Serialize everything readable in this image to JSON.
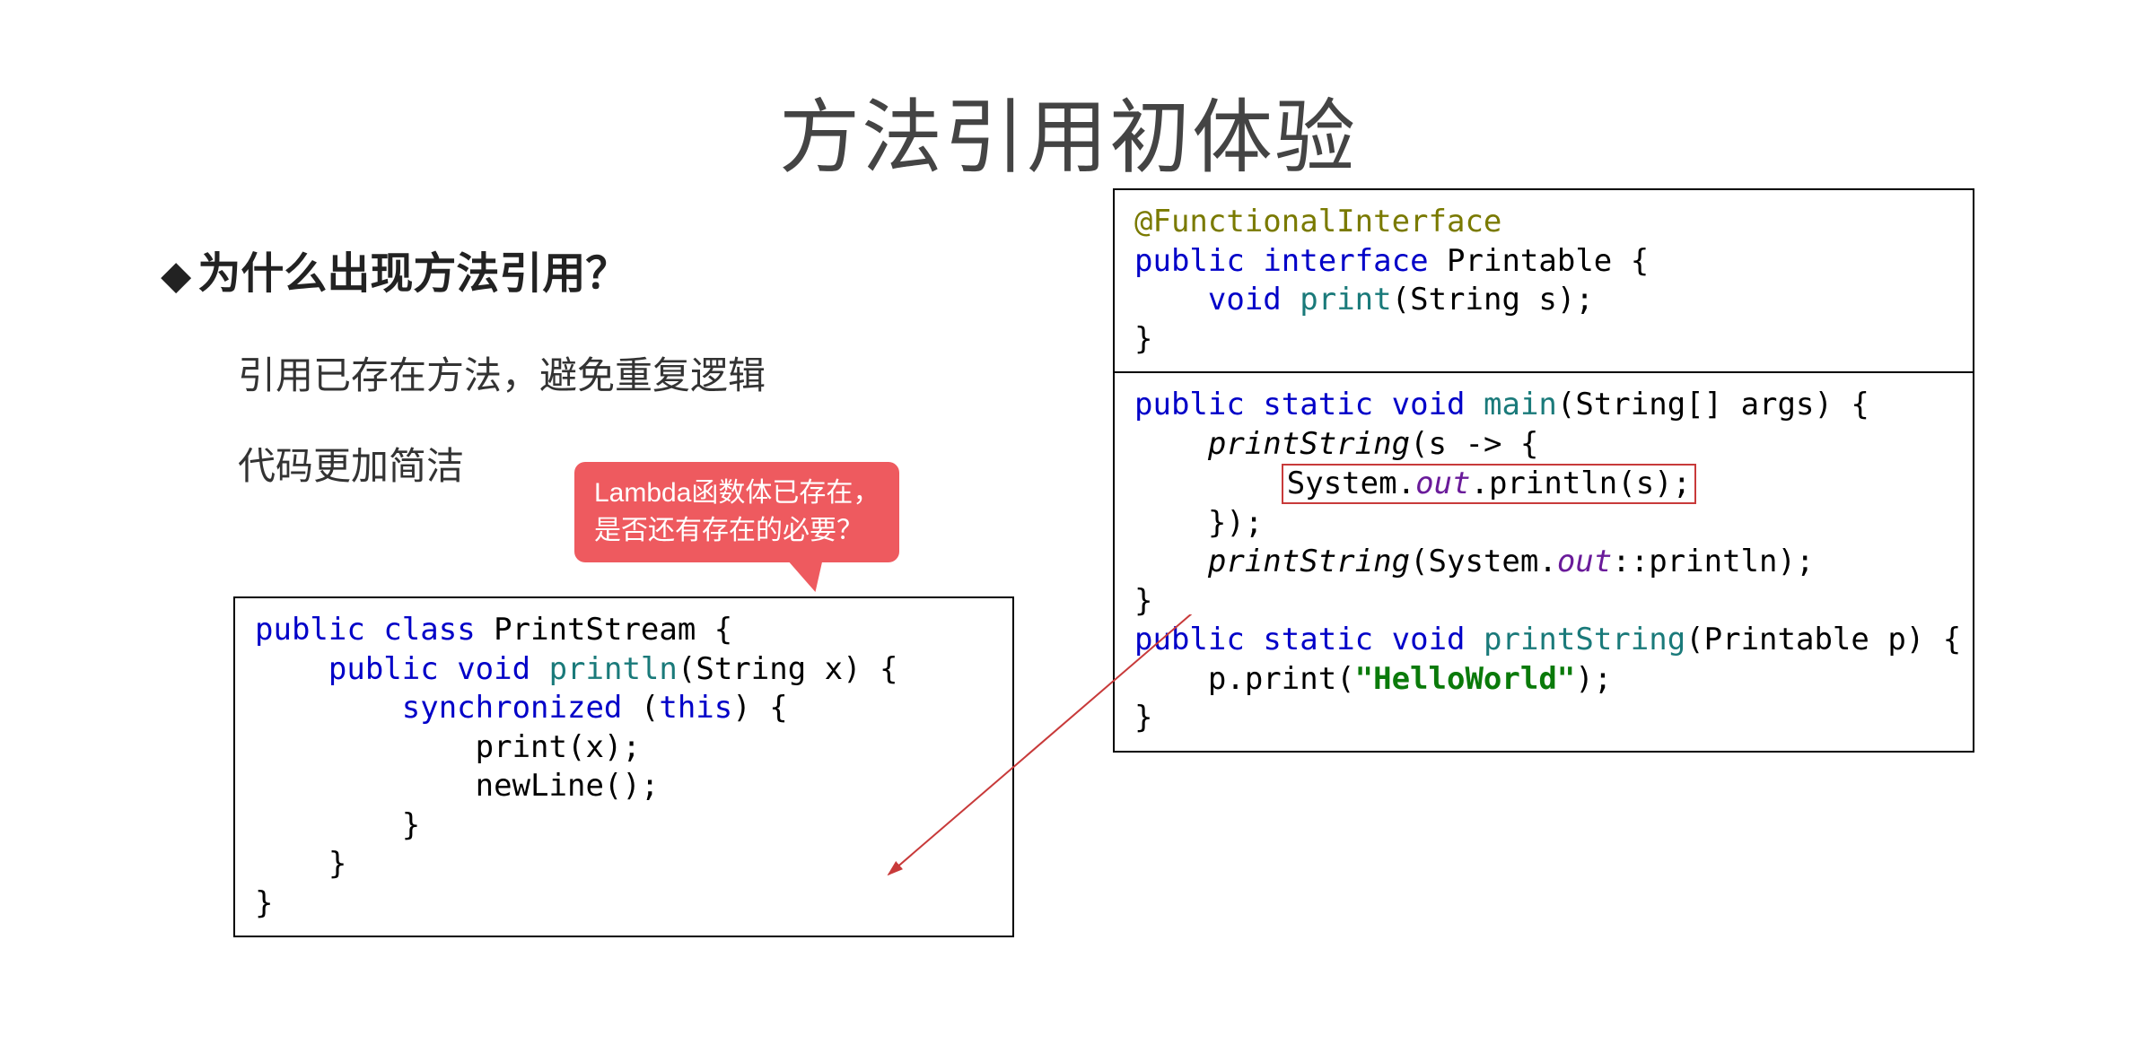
{
  "title": "方法引用初体验",
  "subhead": "为什么出现方法引用？",
  "bullets": {
    "b1": "引用已存在方法，避免重复逻辑",
    "b2": "代码更加简洁"
  },
  "callout": {
    "line1": "Lambda函数体已存在，",
    "line2": "是否还有存在的必要？"
  },
  "code_left": {
    "l1_public": "public",
    "l1_class": "class",
    "l1_name": "PrintStream {",
    "l2_public": "public",
    "l2_void": "void",
    "l2_method": "println",
    "l2_rest": "(String x) {",
    "l3_sync": "synchronized",
    "l3_this": "this",
    "l3_open": " (",
    "l3_close": ") {",
    "l4": "            print(x);",
    "l5": "            newLine();",
    "l6": "        }",
    "l7": "    }",
    "l8": "}"
  },
  "code_right_top": {
    "l1_ann": "@FunctionalInterface",
    "l2_public": "public",
    "l2_interface": "interface",
    "l2_rest": "Printable {",
    "l3_void": "void",
    "l3_method": "print",
    "l3_rest": "(String s);",
    "l4": "}"
  },
  "code_right_bottom": {
    "l1_public": "public",
    "l1_static": "static",
    "l1_void": "void",
    "l1_method": "main",
    "l1_rest": "(String[] args) {",
    "l2_call": "printString",
    "l2_rest": "(s -> {",
    "l3_pre": "System.",
    "l3_out": "out",
    "l3_post": ".println(s);",
    "l4": "    });",
    "l5_call": "printString",
    "l5_pre": "(System.",
    "l5_out": "out",
    "l5_post": "::println);",
    "l6": "}",
    "l7_public": "public",
    "l7_static": "static",
    "l7_void": "void",
    "l7_method": "printString",
    "l7_rest": "(Printable p) {",
    "l8_pre": "    p.print(",
    "l8_str": "\"HelloWorld\"",
    "l8_post": ");",
    "l9": "}"
  }
}
